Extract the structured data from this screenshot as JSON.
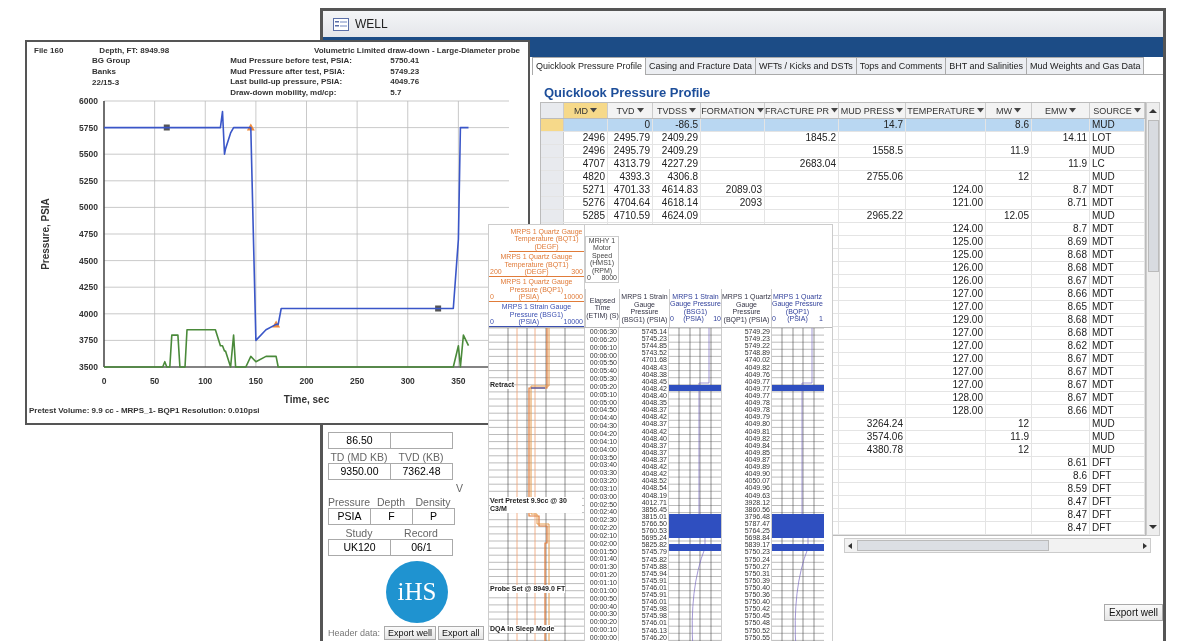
{
  "well_window": {
    "title": "WELL",
    "tabs": [
      {
        "label": "Quicklook Pressure Profile",
        "selected": true
      },
      {
        "label": "Casing and Fracture Data",
        "selected": false
      },
      {
        "label": "WFTs / Kicks and DSTs",
        "selected": false
      },
      {
        "label": "Tops and Comments",
        "selected": false
      },
      {
        "label": "BHT and Salinities",
        "selected": false
      },
      {
        "label": "Mud Weights and Gas Data",
        "selected": false
      }
    ],
    "heading": "Quicklook Pressure Profile",
    "columns": [
      {
        "label": "MD",
        "selected": true
      },
      {
        "label": "TVD",
        "selected": false
      },
      {
        "label": "TVDSS",
        "selected": false
      },
      {
        "label": "FORMATION",
        "selected": false
      },
      {
        "label": "FRACTURE PR",
        "selected": false
      },
      {
        "label": "MUD PRESS",
        "selected": false
      },
      {
        "label": "TEMPERATURE",
        "selected": false
      },
      {
        "label": "MW",
        "selected": false
      },
      {
        "label": "EMW",
        "selected": false
      },
      {
        "label": "SOURCE",
        "selected": false
      }
    ],
    "rows": [
      {
        "selected": true,
        "cells": [
          null,
          "0",
          "-86.5",
          null,
          null,
          "14.7",
          null,
          "8.6",
          null,
          "MUD"
        ]
      },
      {
        "selected": false,
        "cells": [
          "2496",
          "2495.79",
          "2409.29",
          null,
          "1845.2",
          null,
          null,
          null,
          "14.11",
          "LOT"
        ]
      },
      {
        "selected": false,
        "cells": [
          "2496",
          "2495.79",
          "2409.29",
          null,
          null,
          "1558.5",
          null,
          "11.9",
          null,
          "MUD"
        ]
      },
      {
        "selected": false,
        "cells": [
          "4707",
          "4313.79",
          "4227.29",
          null,
          "2683.04",
          null,
          null,
          null,
          "11.9",
          "LC"
        ]
      },
      {
        "selected": false,
        "cells": [
          "4820",
          "4393.3",
          "4306.8",
          null,
          null,
          "2755.06",
          null,
          "12",
          null,
          "MUD"
        ]
      },
      {
        "selected": false,
        "cells": [
          "5271",
          "4701.33",
          "4614.83",
          "2089.03",
          null,
          null,
          "124.00",
          null,
          "8.7",
          "MDT"
        ]
      },
      {
        "selected": false,
        "cells": [
          "5276",
          "4704.64",
          "4618.14",
          "2093",
          null,
          null,
          "121.00",
          null,
          "8.71",
          "MDT"
        ]
      },
      {
        "selected": false,
        "cells": [
          "5285",
          "4710.59",
          "4624.09",
          null,
          null,
          "2965.22",
          null,
          "12.05",
          null,
          "MUD"
        ]
      },
      {
        "selected": false,
        "cells": [
          null,
          null,
          null,
          null,
          null,
          null,
          "124.00",
          null,
          "8.7",
          "MDT"
        ]
      },
      {
        "selected": false,
        "cells": [
          null,
          null,
          null,
          null,
          null,
          null,
          "125.00",
          null,
          "8.69",
          "MDT"
        ]
      },
      {
        "selected": false,
        "cells": [
          null,
          null,
          null,
          null,
          null,
          null,
          "125.00",
          null,
          "8.68",
          "MDT"
        ]
      },
      {
        "selected": false,
        "cells": [
          null,
          null,
          null,
          null,
          null,
          null,
          "126.00",
          null,
          "8.68",
          "MDT"
        ]
      },
      {
        "selected": false,
        "cells": [
          null,
          null,
          null,
          null,
          null,
          null,
          "126.00",
          null,
          "8.67",
          "MDT"
        ]
      },
      {
        "selected": false,
        "cells": [
          null,
          null,
          null,
          null,
          null,
          null,
          "127.00",
          null,
          "8.66",
          "MDT"
        ]
      },
      {
        "selected": false,
        "cells": [
          null,
          null,
          null,
          null,
          null,
          null,
          "127.00",
          null,
          "8.65",
          "MDT"
        ]
      },
      {
        "selected": false,
        "cells": [
          null,
          null,
          null,
          null,
          null,
          null,
          "129.00",
          null,
          "8.68",
          "MDT"
        ]
      },
      {
        "selected": false,
        "cells": [
          null,
          null,
          null,
          null,
          null,
          null,
          "127.00",
          null,
          "8.68",
          "MDT"
        ]
      },
      {
        "selected": false,
        "cells": [
          null,
          null,
          null,
          null,
          null,
          null,
          "127.00",
          null,
          "8.62",
          "MDT"
        ]
      },
      {
        "selected": false,
        "cells": [
          null,
          null,
          null,
          null,
          null,
          null,
          "127.00",
          null,
          "8.67",
          "MDT"
        ]
      },
      {
        "selected": false,
        "cells": [
          null,
          null,
          null,
          null,
          null,
          null,
          "127.00",
          null,
          "8.67",
          "MDT"
        ]
      },
      {
        "selected": false,
        "cells": [
          null,
          null,
          null,
          null,
          null,
          null,
          "127.00",
          null,
          "8.67",
          "MDT"
        ]
      },
      {
        "selected": false,
        "cells": [
          null,
          null,
          null,
          null,
          null,
          null,
          "128.00",
          null,
          "8.67",
          "MDT"
        ]
      },
      {
        "selected": false,
        "cells": [
          null,
          null,
          null,
          null,
          null,
          null,
          "128.00",
          null,
          "8.66",
          "MDT"
        ]
      },
      {
        "selected": false,
        "cells": [
          null,
          null,
          null,
          null,
          null,
          "3264.24",
          null,
          "12",
          null,
          "MUD"
        ]
      },
      {
        "selected": false,
        "cells": [
          null,
          null,
          null,
          null,
          null,
          "3574.06",
          null,
          "11.9",
          null,
          "MUD"
        ]
      },
      {
        "selected": false,
        "cells": [
          null,
          null,
          null,
          null,
          null,
          "4380.78",
          null,
          "12",
          null,
          "MUD"
        ]
      },
      {
        "selected": false,
        "cells": [
          null,
          null,
          null,
          null,
          null,
          null,
          null,
          null,
          "8.61",
          "DFT"
        ]
      },
      {
        "selected": false,
        "cells": [
          null,
          null,
          null,
          null,
          null,
          null,
          null,
          null,
          "8.6",
          "DFT"
        ]
      },
      {
        "selected": false,
        "cells": [
          null,
          null,
          null,
          null,
          null,
          null,
          null,
          null,
          "8.59",
          "DFT"
        ]
      },
      {
        "selected": false,
        "cells": [
          null,
          null,
          null,
          null,
          null,
          null,
          null,
          null,
          "8.47",
          "DFT"
        ]
      },
      {
        "selected": false,
        "cells": [
          null,
          null,
          null,
          null,
          null,
          null,
          null,
          null,
          "8.47",
          "DFT"
        ]
      },
      {
        "selected": false,
        "cells": [
          null,
          null,
          null,
          null,
          null,
          null,
          null,
          null,
          "8.47",
          "DFT"
        ]
      }
    ],
    "export_button": "Export well",
    "left_panel": {
      "groups": [
        {
          "values": [
            "86.50"
          ]
        },
        {
          "labels": [
            "TD (MD KB)",
            "TVD (KB)"
          ],
          "values": [
            "9350.00",
            "7362.48"
          ]
        },
        {
          "labels": [
            "V"
          ]
        },
        {
          "labels": [
            "Pressure",
            "Depth",
            "Density"
          ],
          "values": [
            "PSIA",
            "F",
            "P"
          ]
        },
        {
          "labels": [
            "Study",
            "Record"
          ],
          "values": [
            "UK120",
            "06/1"
          ]
        }
      ],
      "logo": "iHS",
      "header_label": "Header data:",
      "buttons": [
        "Export well",
        "Export all"
      ]
    }
  },
  "chart_window": {
    "file": "File 160",
    "depth": "Depth, FT: 8949.98",
    "title": "Volumetric Limited draw-down - Large-Diameter probe",
    "info": [
      "BG Group",
      "Banks",
      "22/15-3"
    ],
    "stats": [
      {
        "label": "Mud Pressure before test, PSIA:",
        "value": "5750.41"
      },
      {
        "label": "Mud Pressure after test, PSIA:",
        "value": "5749.23"
      },
      {
        "label": "Last build-up pressure, PSIA:",
        "value": "4049.76"
      },
      {
        "label": "Draw-down mobility, md/cp:",
        "value": "5.7"
      }
    ],
    "chart_data": {
      "type": "line",
      "xlabel": "Time, sec",
      "ylabel": "Pressure, PSIA",
      "x": [
        0,
        58,
        60,
        62,
        65,
        67,
        73,
        75,
        80,
        82,
        110,
        115,
        117,
        119,
        120,
        125,
        128,
        130,
        135,
        140,
        145,
        150,
        160,
        170,
        172,
        175,
        200,
        300,
        330,
        345,
        350,
        352,
        355,
        360
      ],
      "series": [
        {
          "color": "#3a56c8",
          "values": [
            5750,
            5750,
            5750,
            5750,
            5750,
            5750,
            5750,
            5750,
            5750,
            5750,
            5750,
            5750,
            5900,
            5500,
            5550,
            5700,
            5750,
            5750,
            5750,
            5750,
            5750,
            3750,
            3850,
            3900,
            3900,
            4050,
            4050,
            4050,
            4050,
            4050,
            4700,
            5750,
            5750,
            5750
          ]
        },
        {
          "color": "#4a8a3a",
          "values": [
            3500,
            3500,
            3550,
            3500,
            3500,
            3800,
            3800,
            3500,
            3500,
            3850,
            3850,
            3700,
            3700,
            3650,
            3650,
            3500,
            3800,
            3500,
            3500,
            3500,
            3600,
            3550,
            3600,
            3600,
            3500,
            3500,
            3500,
            3500,
            3500,
            3500,
            3700,
            3500,
            3800,
            3700
          ]
        }
      ],
      "xlim": [
        0,
        400
      ],
      "ylim": [
        3500,
        6000
      ],
      "grid": true,
      "xticks": [
        0,
        50,
        100,
        150,
        200,
        250,
        300,
        350
      ],
      "yticks": [
        3500,
        3750,
        4000,
        4250,
        4500,
        4750,
        5000,
        5250,
        5500,
        5750,
        6000
      ]
    },
    "footer": "Pretest Volume: 9.9 cc  -  MRPS_1-     BQP1   Resolution: 0.010psi"
  },
  "log": {
    "header_curves": [
      {
        "kind": "caption",
        "title": "MRPS 1 Quartz Gauge Temperature (BQT1) (DEGF)",
        "color": "#e07b39"
      },
      {
        "kind": "scale",
        "title": "MRPS 1 Quartz Gauge Temperature (BQT1)",
        "unit": "(DEGF)",
        "min": "200",
        "max": "300",
        "color": "#e07b39"
      },
      {
        "kind": "scale",
        "title": "MRPS 1 Quartz Gauge Pressure (BQP1)",
        "unit": "(PSIA)",
        "min": "0",
        "max": "10000",
        "color": "#e07b39"
      },
      {
        "kind": "scale",
        "title": "MRPS 1 Strain Gauge Pressure (BSG1)",
        "unit": "(PSIA)",
        "min": "0",
        "max": "10000",
        "color": "#3b4fb0"
      }
    ],
    "motor": {
      "title": "MRHY 1 Motor Speed (HMS1) (RPM)",
      "min": "0",
      "max": "8000"
    },
    "columns": [
      {
        "kind": "time",
        "title": "Elapsed Time (ETIM) (S)",
        "values": [
          "00:06:30",
          "00:06:20",
          "00:06:10",
          "00:06:00",
          "00:05:50",
          "00:05:40",
          "00:05:30",
          "00:05:20",
          "00:05:10",
          "00:05:00",
          "00:04:50",
          "00:04:40",
          "00:04:30",
          "00:04:20",
          "00:04:10",
          "00:04:00",
          "00:03:50",
          "00:03:40",
          "00:03:30",
          "00:03:20",
          "00:03:10",
          "00:03:00",
          "00:02:50",
          "00:02:40",
          "00:02:30",
          "00:02:20",
          "00:02:10",
          "00:02:00",
          "00:01:50",
          "00:01:40",
          "00:01:30",
          "00:01:20",
          "00:01:10",
          "00:01:00",
          "00:00:50",
          "00:00:40",
          "00:00:30",
          "00:00:20",
          "00:00:10",
          "00:00:00"
        ]
      },
      {
        "kind": "values",
        "title": "MRPS 1 Strain Gauge Pressure (BSG1) (PSIA)",
        "values": [
          "5745.14",
          "5745.23",
          "5744.85",
          "5743.52",
          "4701.68",
          "4048.43",
          "4048.38",
          "4048.45",
          "4048.42",
          "4048.40",
          "4048.35",
          "4048.37",
          "4048.42",
          "4048.37",
          "4048.42",
          "4048.40",
          "4048.37",
          "4048.37",
          "4048.37",
          "4048.42",
          "4048.42",
          "4048.52",
          "4048.54",
          "4048.19",
          "4012.71",
          "3856.45",
          "3815.01",
          "5766.50",
          "5760.53",
          "5695.24",
          "5825.82",
          "5745.79",
          "5745.82",
          "5745.88",
          "5745.94",
          "5745.91",
          "5746.01",
          "5745.91",
          "5746.01",
          "5745.98",
          "5745.98",
          "5746.01",
          "5746.13",
          "5746.20"
        ]
      },
      {
        "kind": "track",
        "title": "MRPS 1 Strain Gauge Pressure (BSG1)",
        "unit": "(PSIA)",
        "min": "0",
        "max": "10"
      },
      {
        "kind": "values",
        "title": "MRPS 1 Quartz Gauge Pressure (BQP1) (PSIA)",
        "values": [
          "5749.29",
          "5749.23",
          "5749.22",
          "5748.89",
          "4740.02",
          "4049.82",
          "4049.76",
          "4049.77",
          "4049.77",
          "4049.77",
          "4049.78",
          "4049.78",
          "4049.79",
          "4049.80",
          "4049.81",
          "4049.82",
          "4049.84",
          "4049.85",
          "4049.87",
          "4049.89",
          "4049.90",
          "4050.07",
          "4049.96",
          "4049.63",
          "3928.12",
          "3860.56",
          "3796.48",
          "5787.47",
          "5764.25",
          "5698.84",
          "5839.17",
          "5750.23",
          "5750.24",
          "5750.27",
          "5750.31",
          "5750.39",
          "5750.40",
          "5750.36",
          "5750.40",
          "5750.42",
          "5750.45",
          "5750.48",
          "5750.52",
          "5750.55"
        ]
      },
      {
        "kind": "track",
        "title": "MRPS 1 Quartz Gauge Pressure (BQP1)",
        "unit": "(PSIA)",
        "min": "0",
        "max": "1"
      }
    ],
    "events": [
      "Retract",
      "Vert Pretest 9.9cc @ 30 C3/M",
      "Probe Set @ 8949.0 FT",
      "DQA In Sleep Mode"
    ]
  }
}
